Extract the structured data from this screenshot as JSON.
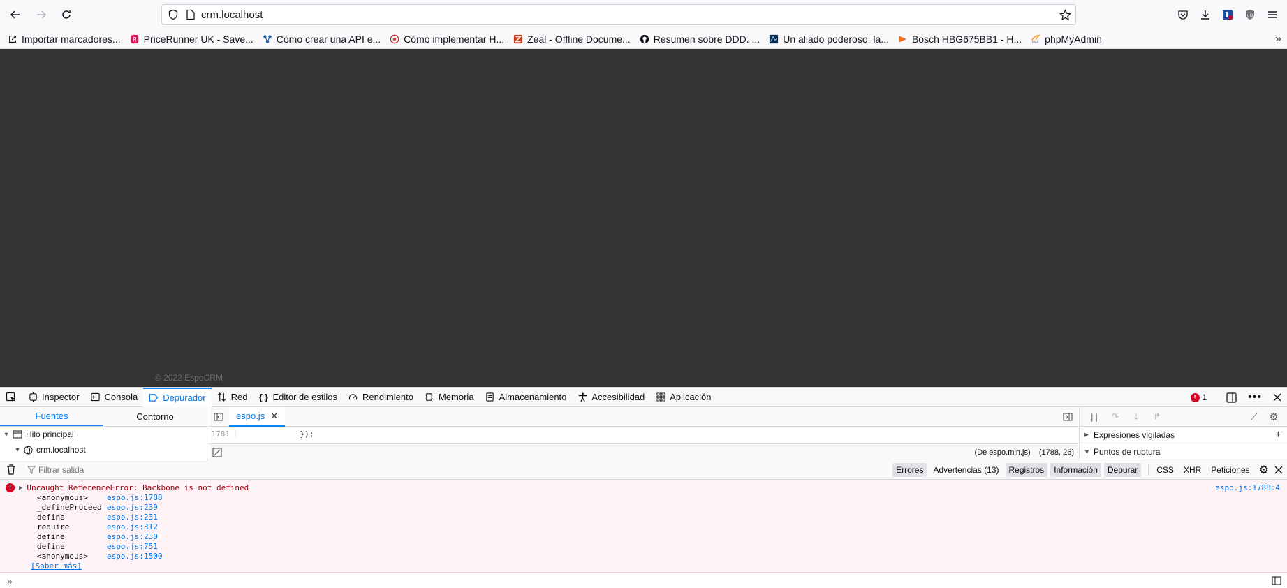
{
  "browser": {
    "url": "crm.localhost",
    "bookmarks": [
      {
        "label": "Importar marcadores...",
        "icon": "import-icon"
      },
      {
        "label": "PriceRunner UK - Save...",
        "icon": "pricerunner-icon"
      },
      {
        "label": "Cómo crear una API e...",
        "icon": "api-icon"
      },
      {
        "label": "Cómo implementar H...",
        "icon": "site-icon"
      },
      {
        "label": "Zeal - Offline Docume...",
        "icon": "zeal-icon"
      },
      {
        "label": "Resumen sobre DDD. ...",
        "icon": "github-icon"
      },
      {
        "label": "Un aliado poderoso: la...",
        "icon": "site-icon"
      },
      {
        "label": "Bosch HBG675BB1 - H...",
        "icon": "site-icon"
      },
      {
        "label": "phpMyAdmin",
        "icon": "phpmyadmin-icon"
      }
    ]
  },
  "page": {
    "copyright": "© 2022 EspoCRM"
  },
  "devtools": {
    "tabs": [
      "Inspector",
      "Consola",
      "Depurador",
      "Red",
      "Editor de estilos",
      "Rendimiento",
      "Memoria",
      "Almacenamiento",
      "Accesibilidad",
      "Aplicación"
    ],
    "active_tab": "Depurador",
    "error_count": "1",
    "debugger": {
      "source_tabs": [
        "Fuentes",
        "Contorno"
      ],
      "tree": [
        {
          "label": "Hilo principal"
        },
        {
          "label": "crm.localhost"
        }
      ],
      "open_file": "espo.js",
      "line_number": "1781",
      "code": "            });",
      "source_map": "(De espo.min.js)",
      "cursor_position": "(1788, 26)",
      "watch_expressions": "Expresiones vigiladas",
      "breakpoints": "Puntos de ruptura"
    },
    "console": {
      "filter_placeholder": "Filtrar salida",
      "filters": [
        {
          "label": "Errores",
          "on": true
        },
        {
          "label": "Advertencias (13)",
          "on": false
        },
        {
          "label": "Registros",
          "on": true
        },
        {
          "label": "Información",
          "on": true
        },
        {
          "label": "Depurar",
          "on": true
        },
        {
          "label": "CSS",
          "on": false
        },
        {
          "label": "XHR",
          "on": false
        },
        {
          "label": "Peticiones",
          "on": false
        }
      ],
      "error_message": "Uncaught ReferenceError: Backbone is not defined",
      "error_location": "espo.js:1788:4",
      "stack": [
        {
          "fn": "<anonymous>",
          "loc": "espo.js:1788"
        },
        {
          "fn": "_defineProceed",
          "loc": "espo.js:239"
        },
        {
          "fn": "define",
          "loc": "espo.js:231"
        },
        {
          "fn": "require",
          "loc": "espo.js:312"
        },
        {
          "fn": "define",
          "loc": "espo.js:230"
        },
        {
          "fn": "define",
          "loc": "espo.js:751"
        },
        {
          "fn": "<anonymous>",
          "loc": "espo.js:1500"
        }
      ],
      "learn_more": "[Saber más]"
    }
  }
}
